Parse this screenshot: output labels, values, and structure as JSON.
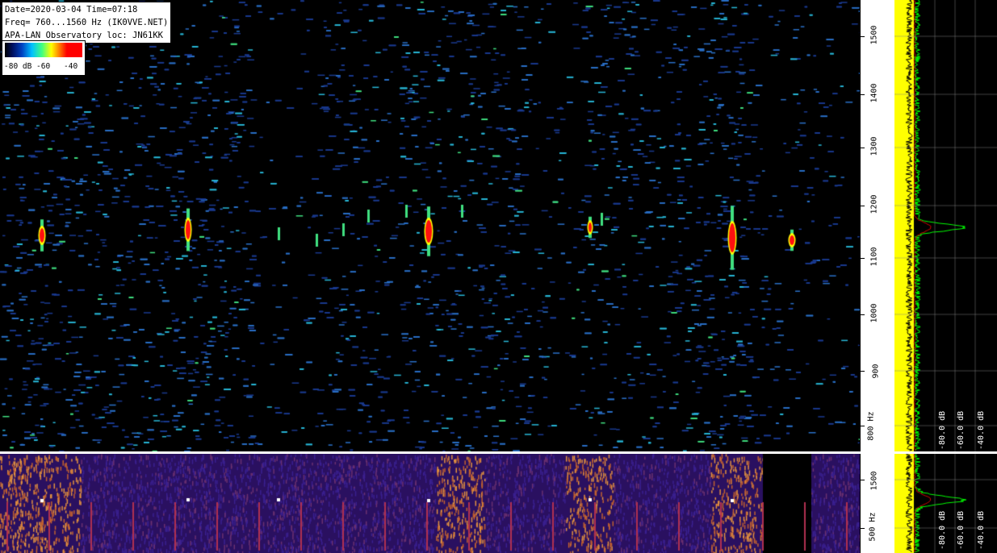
{
  "header": {
    "line1": "Date=2020-03-04 Time=07:18",
    "line2": "Freq= 760...1560 Hz (IK0VVE.NET)",
    "line3": "APA-LAN Observatory loc: JN61KK"
  },
  "colorbar": {
    "label_a": "-80 dB",
    "label_b": "-60",
    "label_c": "-40"
  },
  "freq_axis_top": {
    "ticks": [
      "1500",
      "1400",
      "1300",
      "1200",
      "1100",
      "1000",
      "900",
      "800 Hz"
    ]
  },
  "freq_axis_bot": {
    "ticks": [
      "1500",
      "500 Hz"
    ]
  },
  "profile_top_labels": [
    "-80.0 dB",
    "-60.0 dB",
    "-40.0 dB"
  ],
  "profile_bot_labels": [
    "-80.0 dB",
    "-60.0 dB",
    "-40.0 dB"
  ],
  "colors": {
    "background": "#000000",
    "noise_blue": "#1a3a90",
    "noise_cyan": "#28b8d8",
    "signal_red": "#ff1010",
    "signal_yellow": "#ffff00",
    "profile_yellow": "#ffff00",
    "profile_green": "#00ff00",
    "profile_red": "#d00000",
    "bottom_purple": "#2a1060",
    "bottom_orange": "#e08030"
  }
}
